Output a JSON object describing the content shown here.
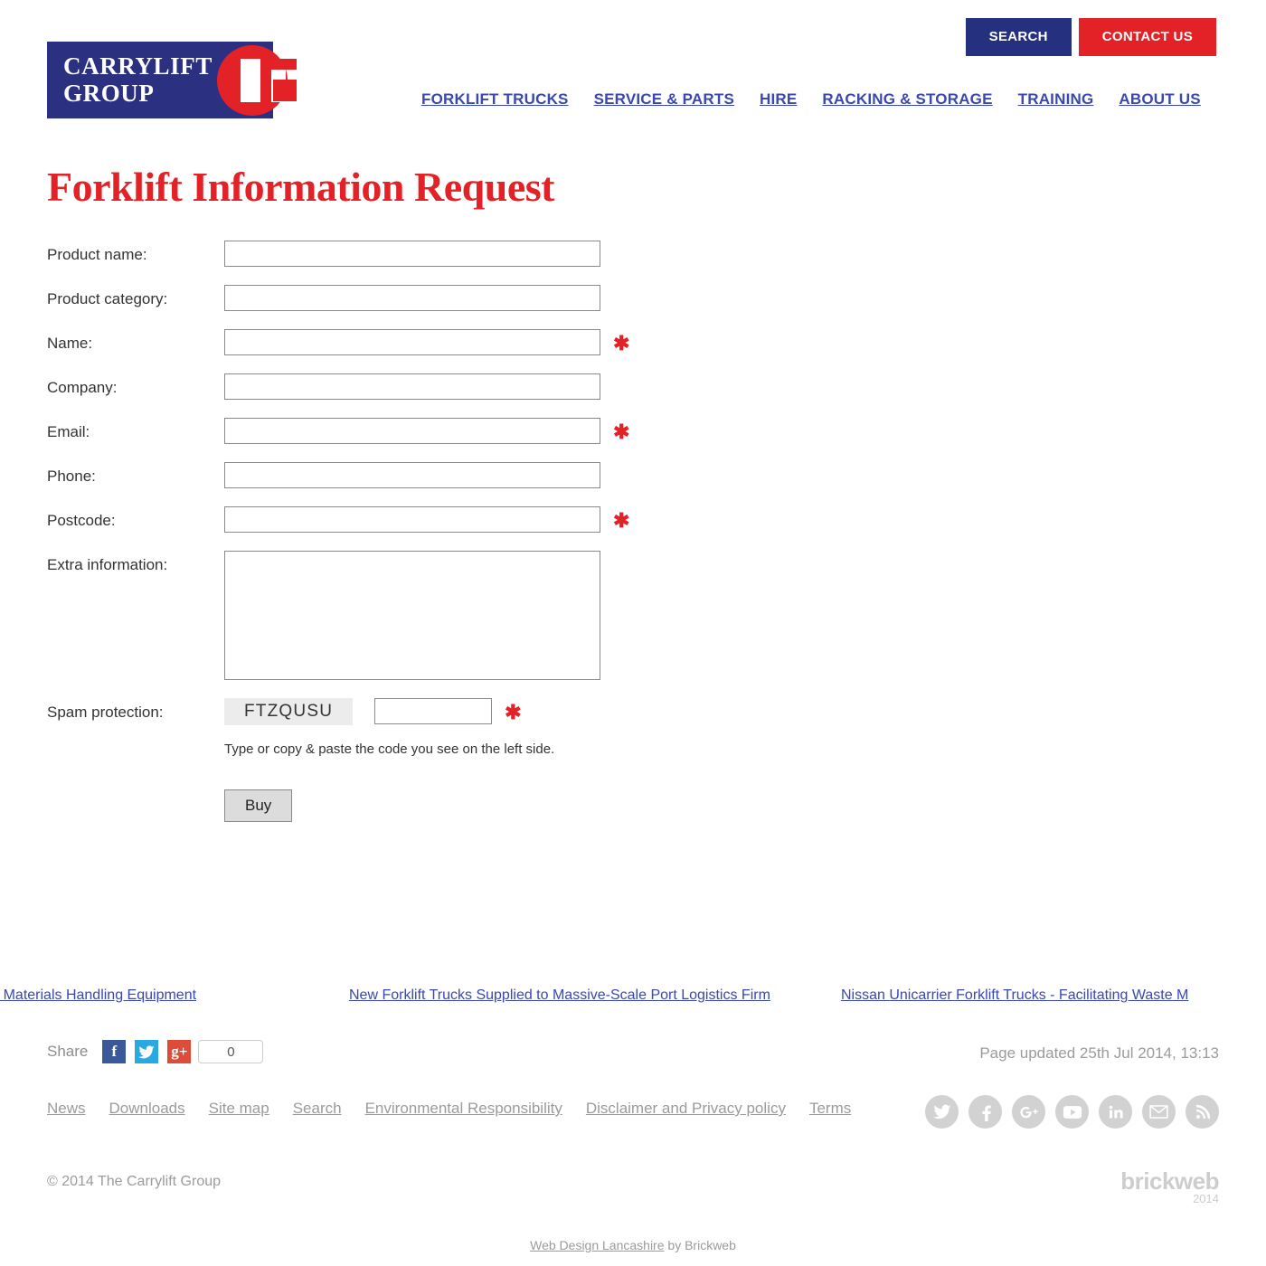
{
  "header": {
    "logo": {
      "line1": "CARRYLIFT",
      "line2": "GROUP",
      "mark": "carrylift-g-logo"
    },
    "search_button": "SEARCH",
    "contact_button": "CONTACT US",
    "nav": [
      {
        "label": "FORKLIFT TRUCKS"
      },
      {
        "label": "SERVICE & PARTS"
      },
      {
        "label": "HIRE"
      },
      {
        "label": "RACKING & STORAGE"
      },
      {
        "label": "TRAINING"
      },
      {
        "label": "ABOUT US"
      }
    ]
  },
  "page": {
    "title": "Forklift Information Request"
  },
  "form": {
    "fields": [
      {
        "label": "Product name:",
        "value": "",
        "required": false,
        "type": "text"
      },
      {
        "label": "Product category:",
        "value": "",
        "required": false,
        "type": "text"
      },
      {
        "label": "Name:",
        "value": "",
        "required": true,
        "type": "text"
      },
      {
        "label": "Company:",
        "value": "",
        "required": false,
        "type": "text"
      },
      {
        "label": "Email:",
        "value": "",
        "required": true,
        "type": "text"
      },
      {
        "label": "Phone:",
        "value": "",
        "required": false,
        "type": "text"
      },
      {
        "label": "Postcode:",
        "value": "",
        "required": true,
        "type": "text"
      },
      {
        "label": "Extra information:",
        "value": "",
        "required": false,
        "type": "textarea"
      }
    ],
    "required_marker": "✱",
    "spam": {
      "label": "Spam protection:",
      "code": "FTZQUSU",
      "input_value": "",
      "help": "Type or copy & paste the code you see on the left side."
    },
    "submit_label": "Buy"
  },
  "news": [
    {
      "text": "s and Materials Handling Equipment"
    },
    {
      "text": "New Forklift Trucks Supplied to Massive-Scale Port Logistics Firm"
    },
    {
      "text": "Nissan Unicarrier Forklift Trucks - Facilitating Waste M"
    }
  ],
  "share": {
    "label": "Share",
    "facebook_glyph": "f",
    "twitter_glyph": "t",
    "googleplus_glyph": "g+",
    "count": "0"
  },
  "page_updated": "Page updated 25th Jul 2014, 13:13",
  "footer": {
    "links": [
      {
        "label": "News"
      },
      {
        "label": "Downloads"
      },
      {
        "label": "Site map"
      },
      {
        "label": "Search"
      },
      {
        "label": "Environmental Responsibility"
      },
      {
        "label": "Disclaimer and Privacy policy"
      },
      {
        "label": "Terms"
      }
    ],
    "socials": [
      {
        "name": "twitter-icon",
        "glyph": "t"
      },
      {
        "name": "facebook-icon",
        "glyph": "f"
      },
      {
        "name": "googleplus-icon",
        "glyph": "g+"
      },
      {
        "name": "youtube-icon",
        "glyph": "Tube"
      },
      {
        "name": "linkedin-icon",
        "glyph": "in"
      },
      {
        "name": "email-icon",
        "glyph": "✉"
      },
      {
        "name": "rss-icon",
        "glyph": "rss"
      }
    ],
    "copyright": "© 2014  The Carrylift Group",
    "brickweb_name": "brickweb",
    "brickweb_year": "2014",
    "credit_link": "Web Design Lancashire",
    "credit_suffix": " by Brickweb"
  },
  "colors": {
    "navy": "#25307E",
    "red": "#E32227",
    "link_blue": "#3A48B0",
    "muted_gray": "#9B9B9B"
  }
}
